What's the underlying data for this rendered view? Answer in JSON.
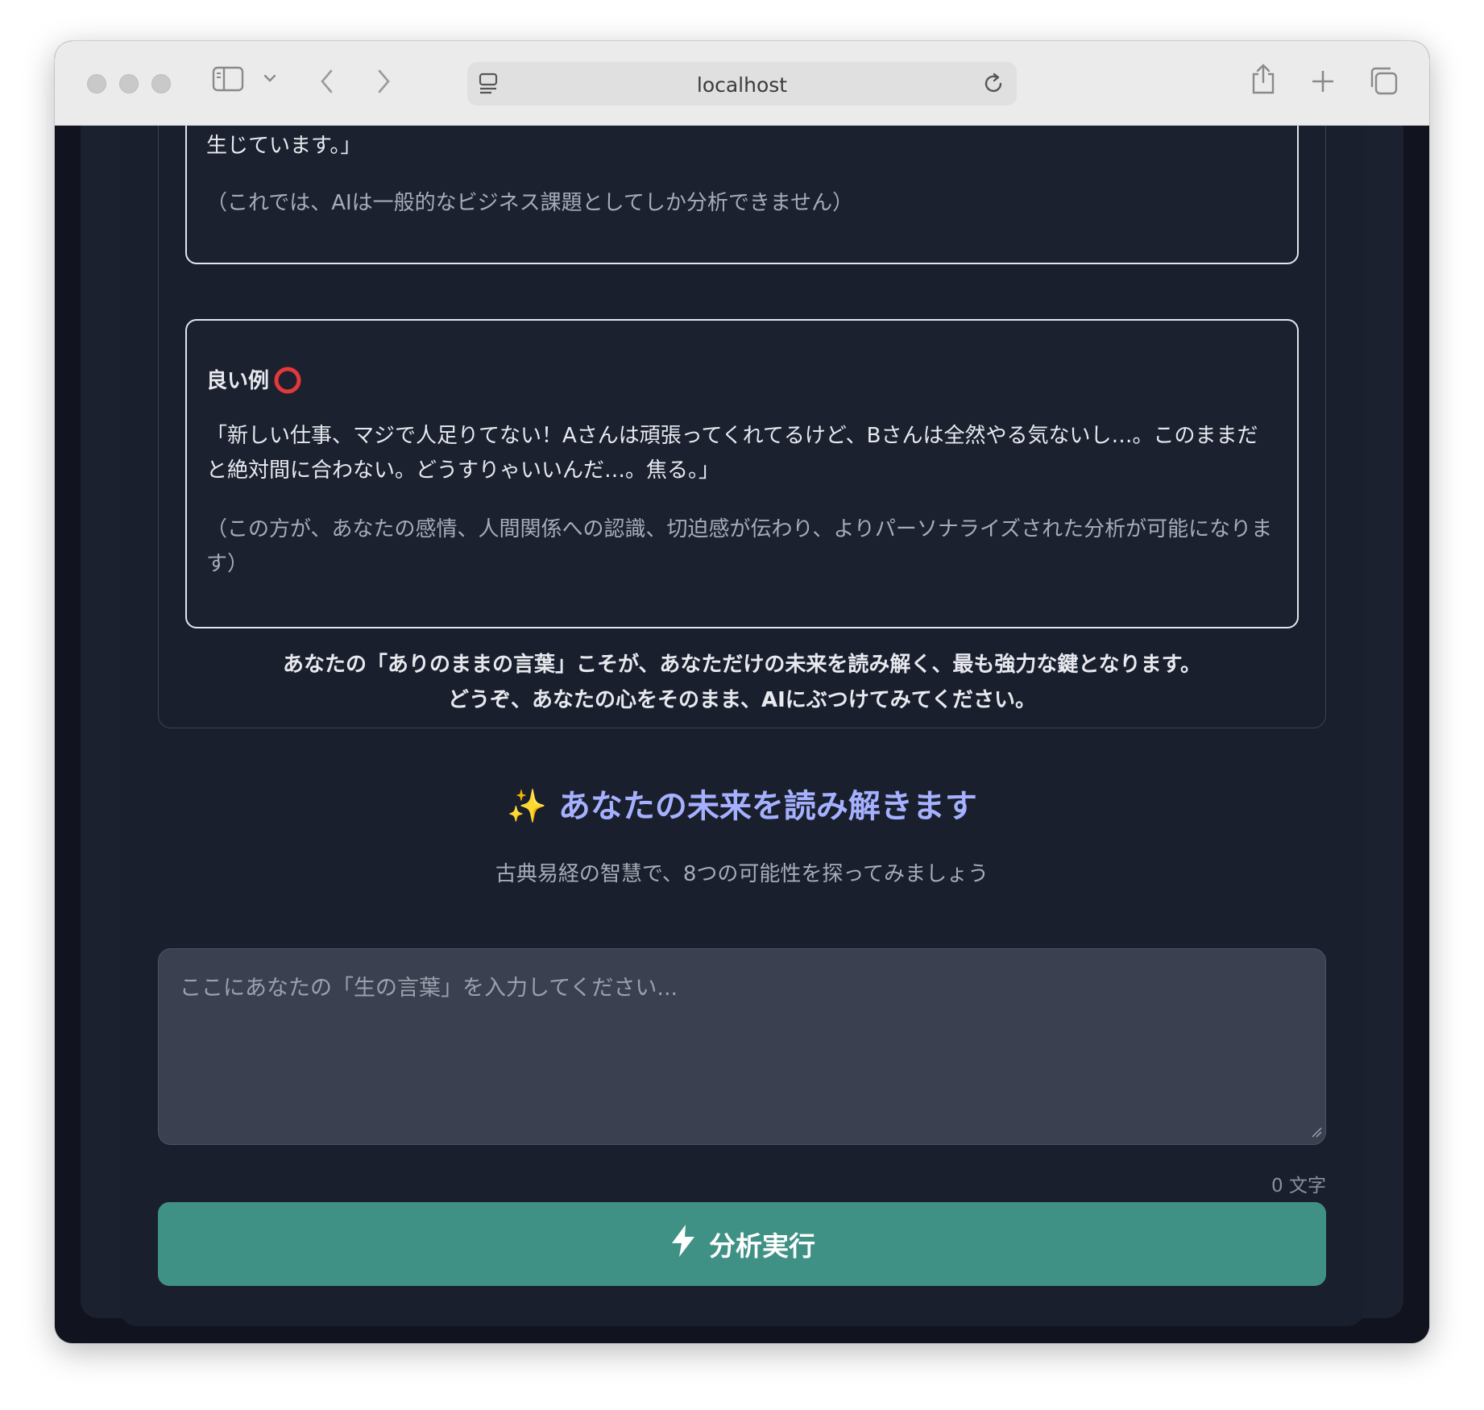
{
  "browser": {
    "url": "localhost"
  },
  "guide": {
    "bad_example_tail": "生じています。」",
    "bad_example_note": "（これでは、AIは一般的なビジネス課題としてしか分析できません）",
    "good_example_title": "良い例",
    "good_example_mark": "⭕",
    "good_example_quote": "「新しい仕事、マジで人足りてない！Aさんは頑張ってくれてるけど、Bさんは全然やる気ないし…。このままだと絶対間に合わない。どうすりゃいいんだ…。焦る。」",
    "good_example_note": "（この方が、あなたの感情、人間関係への認識、切迫感が伝わり、よりパーソナライズされた分析が可能になります）",
    "closing_line1": "あなたの「ありのままの言葉」こそが、あなただけの未来を読み解く、最も強力な鍵となります。",
    "closing_line2": "どうぞ、あなたの心をそのまま、AIにぶつけてみてください。"
  },
  "analysis": {
    "sparkle": "✨",
    "heading": "あなたの未来を読み解きます",
    "subheading": "古典易経の智慧で、8つの可能性を探ってみましょう",
    "input_placeholder": "ここにあなたの「生の言葉」を入力してください...",
    "input_value": "",
    "char_count": "0 文字",
    "run_button_label": "分析実行"
  },
  "colors": {
    "accent_heading": "#a5b1ff",
    "button_bg": "#409185"
  }
}
